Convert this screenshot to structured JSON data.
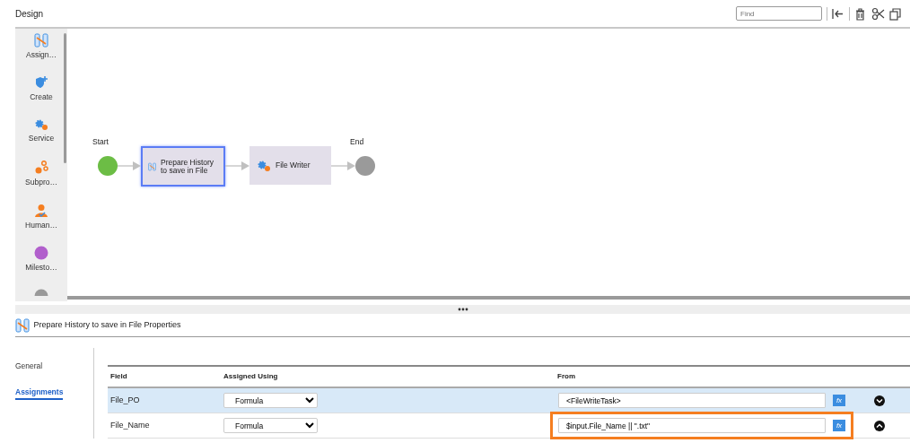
{
  "header": {
    "title": "Design",
    "search": {
      "placeholder": "Find"
    },
    "tools": [
      {
        "kind": "collapse"
      },
      {
        "kind": "delete"
      },
      {
        "kind": "cut"
      },
      {
        "kind": "copy"
      }
    ]
  },
  "palette": [
    {
      "label": "Assign…",
      "kind": "assignment"
    },
    {
      "label": "Create",
      "kind": "create"
    },
    {
      "label": "Service",
      "kind": "service"
    },
    {
      "label": "Subpro…",
      "kind": "subprocess"
    },
    {
      "label": "Human…",
      "kind": "human"
    },
    {
      "label": "Milesto…",
      "kind": "milestone"
    },
    {
      "kind": "more"
    }
  ],
  "diagram": {
    "nodes": [
      {
        "kind": "start",
        "label": "Start"
      },
      {
        "kind": "assignment",
        "label": "Prepare History to save in File",
        "selected": true
      },
      {
        "kind": "service",
        "label": "File Writer",
        "selected": false
      },
      {
        "kind": "end",
        "label": "End"
      }
    ]
  },
  "properties": {
    "title": "Prepare History to save in File Properties",
    "tabs": [
      {
        "label": "General",
        "selected": false
      },
      {
        "label": "Assignments",
        "selected": true
      }
    ],
    "columns": [
      "Field",
      "Assigned Using",
      "From"
    ],
    "rows": [
      {
        "field": "File_PO",
        "assigned_using": "Formula",
        "from": "<FileWriteTask>",
        "formula_button": "fx",
        "selected": true,
        "expanded": false,
        "highlighted": false
      },
      {
        "field": "File_Name",
        "assigned_using": "Formula",
        "from": "$input.File_Name || \".txt\"",
        "formula_button": "fx",
        "selected": false,
        "expanded": true,
        "highlighted": true
      }
    ]
  }
}
